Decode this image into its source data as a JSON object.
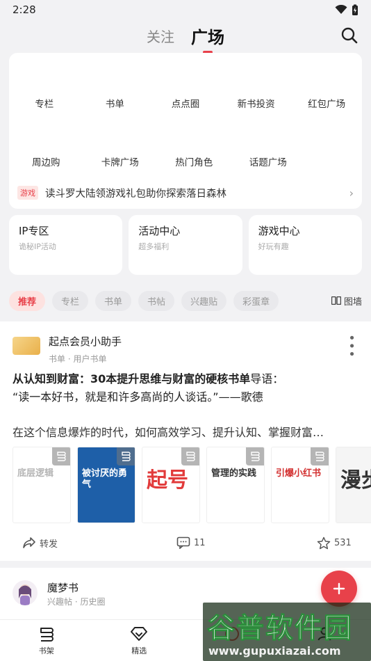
{
  "status": {
    "time": "2:28"
  },
  "header": {
    "tabs": [
      {
        "label": "关注"
      },
      {
        "label": "广场"
      }
    ]
  },
  "grid": {
    "row1": [
      "专栏",
      "书单",
      "点点圈",
      "新书投资",
      "红包广场"
    ],
    "row2": [
      "周边购",
      "卡牌广场",
      "热门角色",
      "话题广场"
    ]
  },
  "promo": {
    "tag": "游戏",
    "text": "读斗罗大陆领游戏礼包助你探索落日森林"
  },
  "features": [
    {
      "title": "IP专区",
      "sub": "诡秘IP活动"
    },
    {
      "title": "活动中心",
      "sub": "超多福利"
    },
    {
      "title": "游戏中心",
      "sub": "好玩有趣"
    }
  ],
  "filters": [
    "推荐",
    "专栏",
    "书单",
    "书帖",
    "兴趣贴",
    "彩蛋章"
  ],
  "filter_right": "图墙",
  "post": {
    "author": "起点会员小助手",
    "meta": "书单 · 用户书单",
    "title_bold": "从认知到财富：30本提升思维与财富的硬核书单",
    "title_rest": "导语：",
    "quote": "“读一本好书，就是和许多高尚的人谈话。”——歌德",
    "excerpt": "在这个信息爆炸的时代，如何高效学习、提升认知、掌握财富…",
    "books": [
      {
        "title": "底层逻辑",
        "bg": "#ffffff",
        "fg": "#b5b5b5"
      },
      {
        "title": "被讨厌的勇气",
        "bg": "#1e5fa8",
        "fg": "#ffffff"
      },
      {
        "title": "起号",
        "bg": "#ffffff",
        "fg": "#e23b3b"
      },
      {
        "title": "管理的实践",
        "bg": "#ffffff",
        "fg": "#333333"
      },
      {
        "title": "引爆小红书",
        "bg": "#ffffff",
        "fg": "#d33131"
      },
      {
        "title": "漫步",
        "bg": "#f5f5f5",
        "fg": "#333333"
      }
    ],
    "share": "转发",
    "comments": "11",
    "likes": "531"
  },
  "post2": {
    "author": "魔梦书",
    "meta": "兴趣帖 · 历史圈"
  },
  "nav": [
    {
      "label": "书架"
    },
    {
      "label": "精选"
    },
    {
      "label": ""
    },
    {
      "label": ""
    }
  ],
  "watermark": {
    "title": "谷普软件园",
    "url": "www.gupuxiazai.com"
  },
  "colors": {
    "accent": "#e8414a"
  }
}
